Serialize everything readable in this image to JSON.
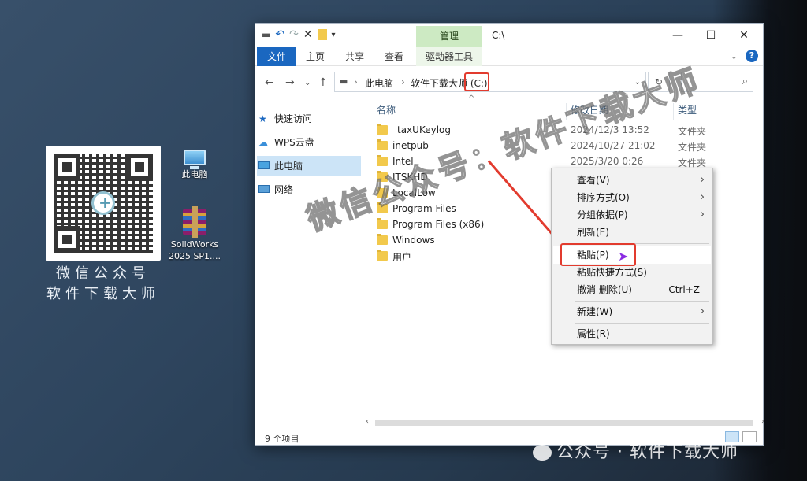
{
  "desktop": {
    "qr_caption_line1": "微信公众号",
    "qr_caption_line2": "软件下载大师",
    "icons": [
      {
        "label": "此电脑",
        "icon": "computer-icon"
      },
      {
        "label": "SolidWorks 2025 SP1....",
        "icon": "winrar-archive-icon"
      }
    ]
  },
  "window": {
    "title": "C:\\",
    "contextual_tab": "管理",
    "ribbon_tabs": [
      "文件",
      "主页",
      "共享",
      "查看",
      "驱动器工具"
    ],
    "window_controls": {
      "minimize": "—",
      "maximize": "☐",
      "close": "✕"
    },
    "address": {
      "crumbs": [
        "此电脑",
        "软件下载大师 (C:)"
      ],
      "search_placeholder": ""
    },
    "nav_pane": [
      {
        "label": "快速访问",
        "icon": "star-icon"
      },
      {
        "label": "WPS云盘",
        "icon": "cloud-icon"
      },
      {
        "label": "此电脑",
        "icon": "computer-icon",
        "selected": true
      },
      {
        "label": "网络",
        "icon": "network-icon"
      }
    ],
    "columns": {
      "name": "名称",
      "date": "修改日期",
      "type": "类型"
    },
    "files": [
      {
        "name": "_taxUKeylog",
        "date": "2024/12/3 13:52",
        "type": "文件夹"
      },
      {
        "name": "inetpub",
        "date": "2024/10/27 21:02",
        "type": "文件夹"
      },
      {
        "name": "Intel",
        "date": "2025/3/20 0:26",
        "type": "文件夹"
      },
      {
        "name": "ITSKHD",
        "date": "",
        "type": ""
      },
      {
        "name": "LocalLow",
        "date": "",
        "type": ""
      },
      {
        "name": "Program Files",
        "date": "",
        "type": ""
      },
      {
        "name": "Program Files (x86)",
        "date": "",
        "type": ""
      },
      {
        "name": "Windows",
        "date": "",
        "type": ""
      },
      {
        "name": "用户",
        "date": "",
        "type": ""
      }
    ],
    "status": "9 个项目"
  },
  "context_menu": {
    "items": [
      {
        "label": "查看(V)",
        "submenu": true
      },
      {
        "label": "排序方式(O)",
        "submenu": true
      },
      {
        "label": "分组依据(P)",
        "submenu": true
      },
      {
        "label": "刷新(E)"
      },
      {
        "label": "粘贴(P)",
        "highlighted": true
      },
      {
        "label": "粘贴快捷方式(S)"
      },
      {
        "label": "撤消 删除(U)",
        "shortcut": "Ctrl+Z"
      },
      {
        "label": "新建(W)",
        "submenu": true
      },
      {
        "label": "属性(R)"
      }
    ]
  },
  "watermarks": {
    "diagonal": "微信公众号：软件下载大师",
    "corner": "公众号 · 软件下载大师"
  },
  "colors": {
    "accent": "#1a67c0",
    "annotation": "#e23b2e",
    "selection": "#cce4f7",
    "manage_tab": "#cdeac3"
  }
}
